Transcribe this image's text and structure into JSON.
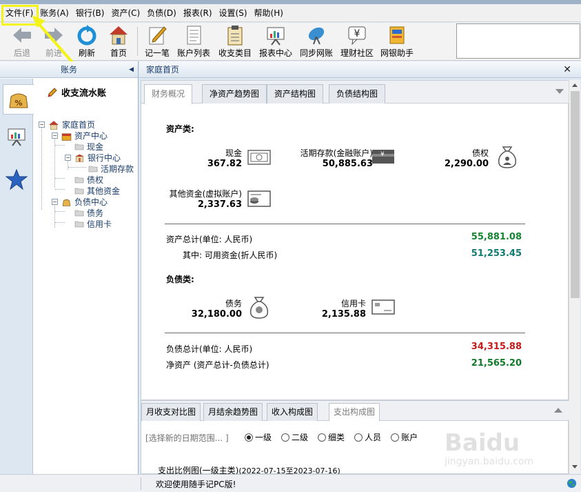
{
  "menu": [
    "文件(F)",
    "账务(A)",
    "银行(B)",
    "资产(C)",
    "负债(D)",
    "报表(R)",
    "设置(S)",
    "帮助(H)"
  ],
  "toolbar": {
    "back": "后退",
    "forward": "前进",
    "refresh": "刷新",
    "home": "首页",
    "record": "记一笔",
    "account_list": "账户列表",
    "category": "收支类目",
    "report": "报表中心",
    "sync": "同步网账",
    "community": "理财社区",
    "assistant": "网银助手"
  },
  "left": {
    "header": "账务",
    "flow_book": "收支流水账",
    "tree": {
      "home": "家庭首页",
      "assets": "资产中心",
      "cash": "现金",
      "bank": "银行中心",
      "demand": "活期存款",
      "creditor": "债权",
      "other_funds": "其他资金",
      "liabilities": "负债中心",
      "debt": "债务",
      "credit_card": "信用卡"
    }
  },
  "main": {
    "header": "家庭首页",
    "tabs": [
      "财务概况",
      "净资产趋势图",
      "资产结构图",
      "负债结构图"
    ],
    "assets_title": "资产类:",
    "assets": {
      "cash": {
        "name": "现金",
        "value": "367.82"
      },
      "demand": {
        "name": "活期存款(金融账户)",
        "value": "50,885.63"
      },
      "creditor": {
        "name": "债权",
        "value": "2,290.00"
      },
      "other": {
        "name": "其他资金(虚拟账户)",
        "value": "2,337.63"
      }
    },
    "asset_total_label": "资产总计(单位: 人民币)",
    "asset_total_value": "55,881.08",
    "available_label": "其中: 可用资金(折人民币)",
    "available_value": "51,253.45",
    "liab_title": "负债类:",
    "liabilities": {
      "debt": {
        "name": "债务",
        "value": "32,180.00"
      },
      "credit_card": {
        "name": "信用卡",
        "value": "2,135.88"
      }
    },
    "liab_total_label": "负债总计(单位: 人民币)",
    "liab_total_value": "34,315.88",
    "net_label": "净资产 (资产总计-负债总计)",
    "net_value": "21,565.20"
  },
  "bottom": {
    "tabs": [
      "月收支对比图",
      "月结余趋势图",
      "收入构成图",
      "支出构成图"
    ],
    "date_range": "[选择新的日期范围...  ]",
    "radios": [
      "一级",
      "二级",
      "细类",
      "人员",
      "账户"
    ],
    "chart_title": "支出比例图(一级主类)",
    "chart_range": "(2022-07-15至2023-07-16)"
  },
  "status": "欢迎使用随手记PC版!",
  "colors": {
    "positive": "#13862f",
    "negative": "#c51a1a",
    "highlight": "#f3f31a"
  }
}
